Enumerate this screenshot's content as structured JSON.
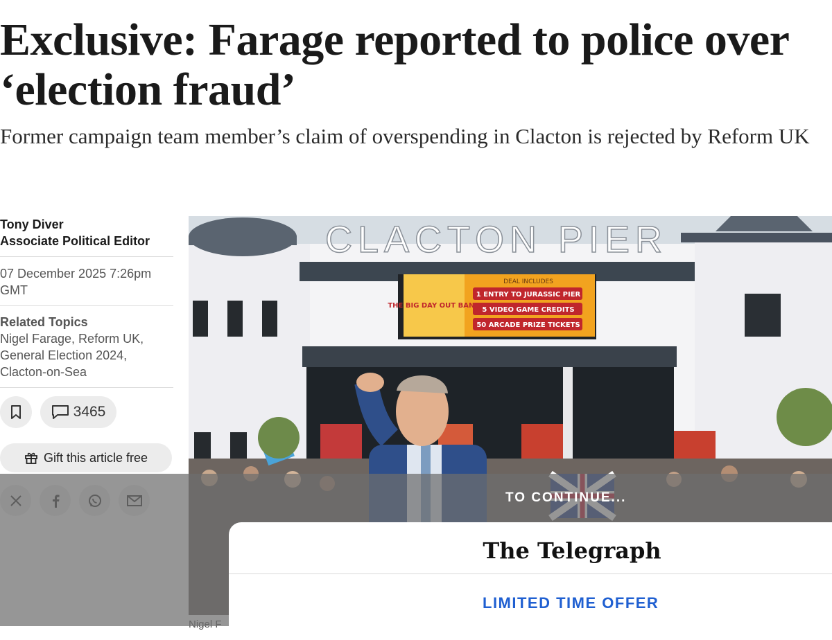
{
  "article": {
    "headline": "Exclusive: Farage reported to police over ‘election fraud’",
    "standfirst": "Former campaign team member’s claim of overspending in Clacton is rejected by Reform UK"
  },
  "byline": {
    "author_name": "Tony Diver",
    "author_role": "Associate Political Editor",
    "date": "07 December 2025 7:26pm GMT",
    "related_topics_title": "Related Topics",
    "related_topics": "Nigel Farage, Reform UK, General Election 2024, Clacton-on-Sea",
    "comment_count": "3465",
    "gift_label": "Gift this article free"
  },
  "share_icons": [
    "x-icon",
    "facebook-icon",
    "whatsapp-icon",
    "email-icon"
  ],
  "photo": {
    "sign_text": "CLACTON PIER",
    "billboard_left": "THE BIG DAY OUT BAND",
    "billboard_header": "DEAL INCLUDES",
    "billboard_items": [
      "1 ENTRY TO JURASSIC PIER",
      "5 VIDEO GAME CREDITS",
      "50 ARCADE PRIZE TICKETS"
    ],
    "caption": "Nigel F"
  },
  "paywall": {
    "continue_text": "TO CONTINUE...",
    "brand": "The Telegraph",
    "offer": "LIMITED TIME OFFER"
  },
  "colors": {
    "offer_blue": "#1f5fd1",
    "overlay_gray": "#6e6e6e"
  }
}
